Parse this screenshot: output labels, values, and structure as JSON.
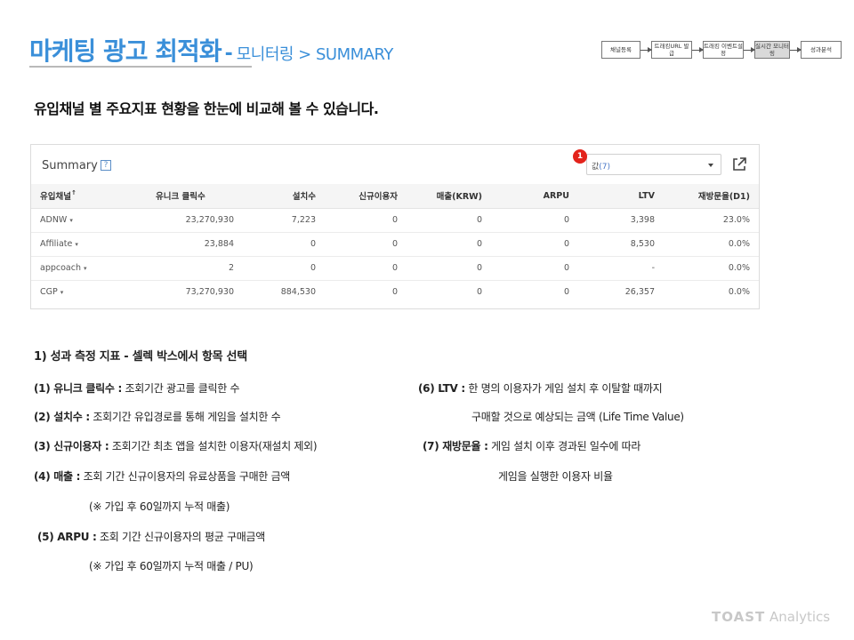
{
  "header": {
    "title": "마케팅 광고 최적화",
    "dash": "-",
    "subtitle": "모니터링 > SUMMARY"
  },
  "flow": [
    "채널등록",
    "트래킹URL 발급",
    "트래킹 이벤트설정",
    "실시간 모니터링",
    "성과분석"
  ],
  "intro": "유입채널 별 주요지표 현황을 한눈에 비교해 볼 수 있습니다.",
  "summary": {
    "title": "Summary",
    "help": "?",
    "badge": "1",
    "select_value": "값",
    "select_hint": "(7)",
    "columns": [
      "유입채널",
      "유니크 클릭수",
      "설치수",
      "신규이용자",
      "매출(KRW)",
      "ARPU",
      "LTV",
      "재방문율(D1)"
    ],
    "rows": [
      {
        "channel": "ADNW",
        "unique_clicks": "23,270,930",
        "installs": "7,223",
        "new_users": "0",
        "revenue": "0",
        "arpu": "0",
        "ltv": "3,398",
        "revisit": "23.0%"
      },
      {
        "channel": "Affiliate",
        "unique_clicks": "23,884",
        "installs": "0",
        "new_users": "0",
        "revenue": "0",
        "arpu": "0",
        "ltv": "8,530",
        "revisit": "0.0%"
      },
      {
        "channel": "appcoach",
        "unique_clicks": "2",
        "installs": "0",
        "new_users": "0",
        "revenue": "0",
        "arpu": "0",
        "ltv": "-",
        "revisit": "0.0%"
      },
      {
        "channel": "CGP",
        "unique_clicks": "73,270,930",
        "installs": "884,530",
        "new_users": "0",
        "revenue": "0",
        "arpu": "0",
        "ltv": "26,357",
        "revisit": "0.0%"
      }
    ]
  },
  "notes": {
    "heading": "1) 성과 측정 지표 - 셀렉 박스에서 항목 선택",
    "n1_label": "(1) 유니크 클릭수 :",
    "n1_text": " 조회기간 광고를 클릭한 수",
    "n2_label": "(2) 설치수 :",
    "n2_text": " 조회기간 유입경로를 통해 게임을 설치한 수",
    "n3_label": "(3) 신규이용자 :",
    "n3_text": " 조회기간 최초 앱을 설치한 이용자(재설치 제외)",
    "n4_label": "(4) 매출 :",
    "n4_text": " 조회 기간 신규이용자의 유료상품을 구매한 금액",
    "n4_sub": "(※ 가입 후 60일까지 누적 매출)",
    "n5_label": "(5) ARPU :",
    "n5_text": " 조회 기간 신규이용자의 평균 구매금액",
    "n5_sub": "(※ 가입 후 60일까지 누적 매출 / PU)",
    "n6_label": "(6) LTV :",
    "n6_text": " 한 명의 이용자가 게임 설치 후 이탈할 때까지",
    "n6_cont": "구매할 것으로 예상되는 금액 (Life Time Value)",
    "n7_label": "(7) 재방문율 :",
    "n7_text": " 게임 설치 이후 경과된 일수에 따라",
    "n7_cont": "게임을 실행한 이용자 비율"
  },
  "brand": {
    "name": "TOAST",
    "suffix": " Analytics"
  },
  "colors": {
    "accent": "#3a8fd9",
    "badge": "#e3231b",
    "link": "#4a78c8"
  }
}
